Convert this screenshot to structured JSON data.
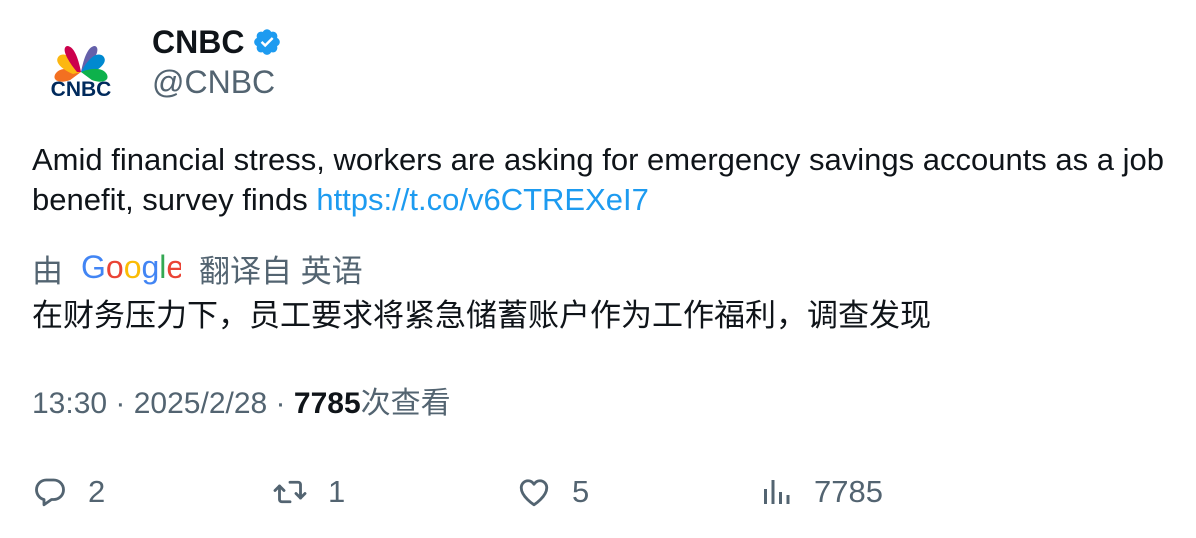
{
  "author": {
    "name": "CNBC",
    "handle": "@CNBC",
    "logo_text": "CNBC",
    "verified": true
  },
  "tweet": {
    "text": "Amid financial stress, workers are asking for emergency savings accounts as a job benefit, survey finds ",
    "link": "https://t.co/v6CTREXeI7"
  },
  "translation": {
    "prefix": "由",
    "provider": "Google",
    "suffix": "翻译自 英语",
    "text": "在财务压力下，员工要求将紧急储蓄账户作为工作福利，调查发现"
  },
  "meta": {
    "time": "13:30",
    "separator": " · ",
    "date": "2025/2/28",
    "views": "7785",
    "views_label": "次查看"
  },
  "actions": {
    "replies": "2",
    "retweets": "1",
    "likes": "5",
    "views": "7785"
  },
  "colors": {
    "link": "#1d9bf0",
    "secondary_text": "#536471",
    "verified": "#1d9bf0"
  }
}
